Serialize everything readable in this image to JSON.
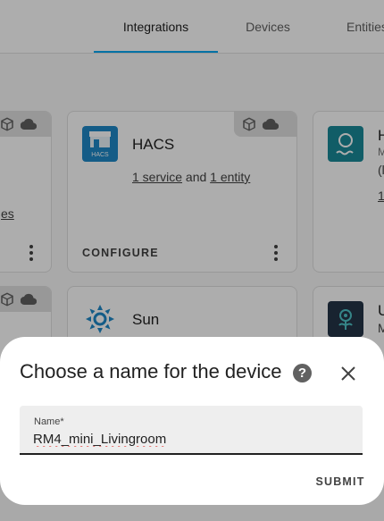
{
  "tabs": [
    {
      "label": "Integrations",
      "active": true
    },
    {
      "label": "Devices",
      "active": false
    },
    {
      "label": "Entities",
      "active": false
    }
  ],
  "cards": {
    "left_partial": {
      "link_fragment": "es"
    },
    "hacs": {
      "title": "HACS",
      "logo_text": "HACS",
      "service_link": "1 service",
      "joiner": "and",
      "entity_link": "1 entity",
      "configure_label": "CONFIGURE",
      "logo_color": "#1e88c7"
    },
    "right_partial_1": {
      "title": "H",
      "sub1": "M",
      "sub2": "(l",
      "link": "1"
    },
    "sun": {
      "title": "Sun",
      "icon_color": "#1e88c7"
    },
    "right_partial_2": {
      "title": "U",
      "sub1": "M"
    }
  },
  "dialog": {
    "title": "Choose a name for the device",
    "help_icon": "?",
    "field_label": "Name*",
    "field_value": "RM4_mini_Livingroom",
    "submit_label": "SUBMIT"
  }
}
